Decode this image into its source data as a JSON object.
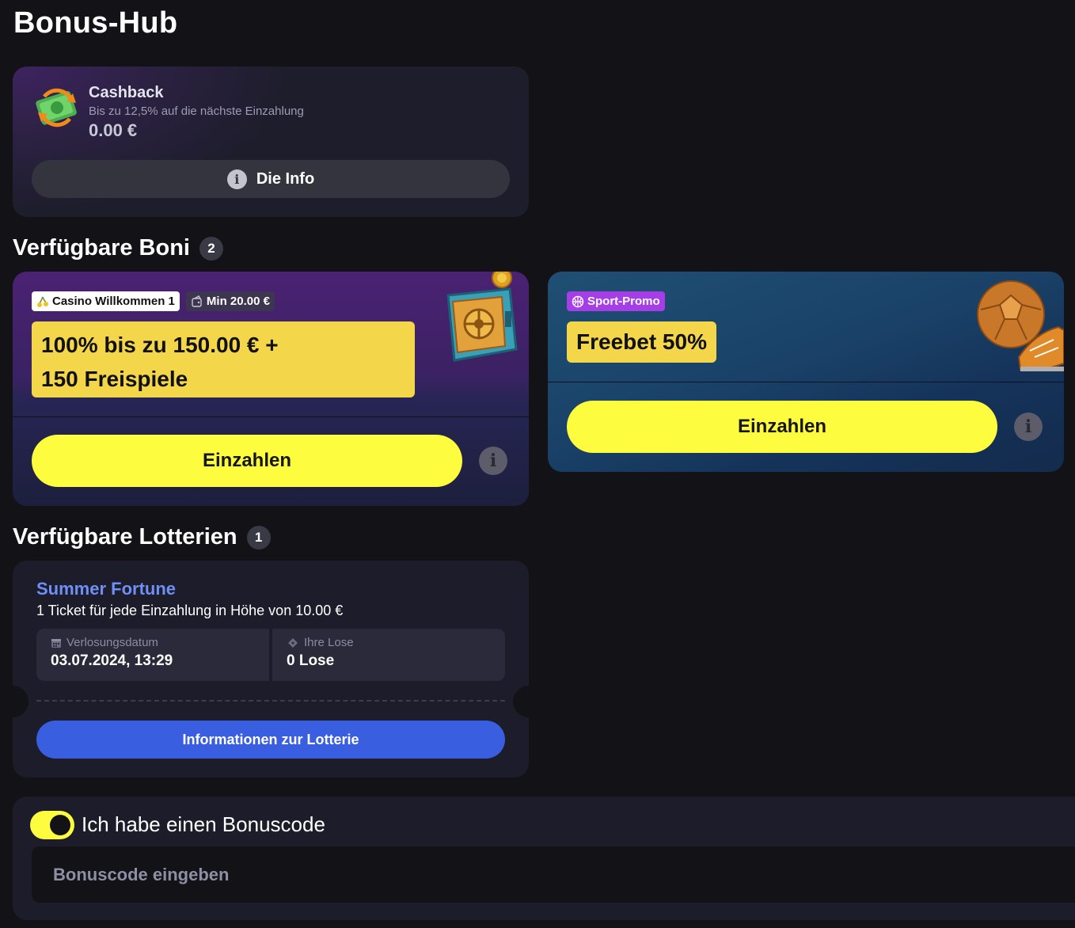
{
  "page": {
    "title": "Bonus-Hub"
  },
  "cashback": {
    "title": "Cashback",
    "subtitle": "Bis zu 12,5% auf die nächste Einzahlung",
    "amount": "0.00 €",
    "info_label": "Die Info",
    "icon": "cash-refresh-icon"
  },
  "available_bonuses": {
    "heading": "Verfügbare Boni",
    "count": "2",
    "cards": [
      {
        "tag": "Casino Willkommen 1",
        "tag_icon": "cherry-icon",
        "min_tag": "Min 20.00 €",
        "min_icon": "wallet-icon",
        "headline_line1": "100% bis zu 150.00 € +",
        "headline_line2": "150 Freispiele",
        "button": "Einzahlen",
        "illustration": "safe-icon"
      },
      {
        "tag": "Sport-Promo",
        "tag_icon": "basketball-icon",
        "headline": "Freebet 50%",
        "button": "Einzahlen",
        "illustration": "football-boot-icon"
      }
    ]
  },
  "lotteries": {
    "heading": "Verfügbare Lotterien",
    "count": "1",
    "items": [
      {
        "title": "Summer Fortune",
        "description": "1 Ticket für jede Einzahlung in Höhe von 10.00 €",
        "draw_date_label": "Verlosungsdatum",
        "draw_date": "03.07.2024, 13:29",
        "tickets_label": "Ihre Lose",
        "tickets": "0 Lose",
        "button": "Informationen zur Lotterie"
      }
    ]
  },
  "bonus_code": {
    "toggle_label": "Ich habe einen Bonuscode",
    "toggle_on": true,
    "placeholder": "Bonuscode eingeben",
    "value": ""
  },
  "colors": {
    "background": "#121217",
    "card": "#1c1c2b",
    "accent_yellow": "#fdfc3e",
    "headline_yellow": "#f4d64a",
    "lottery_blue": "#3a5ee0",
    "lottery_title": "#6f8ff5",
    "sport_tag": "#a63ee8"
  }
}
